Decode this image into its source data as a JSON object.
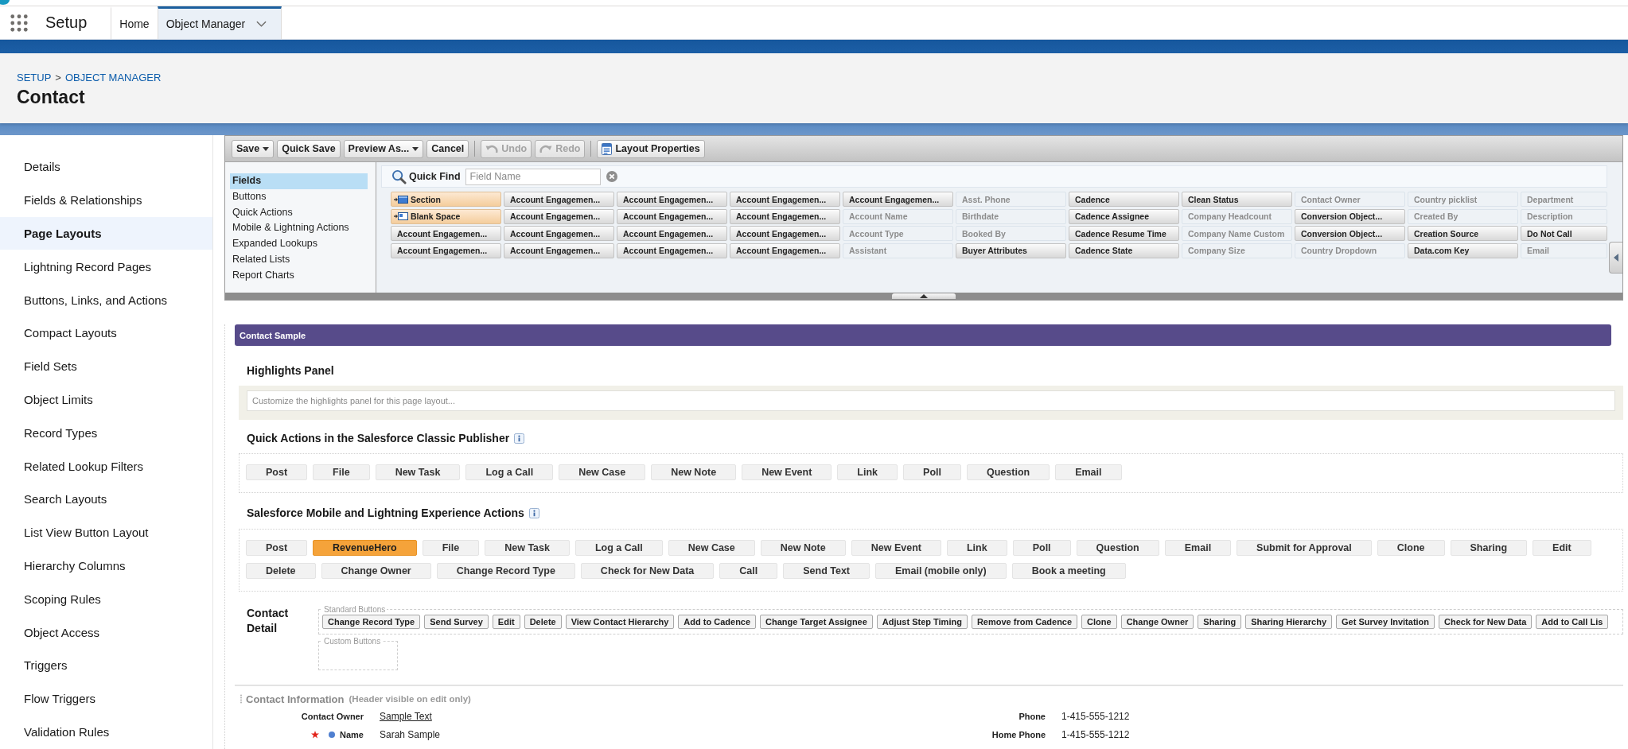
{
  "header": {
    "app_name": "Setup",
    "tabs": [
      {
        "label": "Home",
        "selected": false,
        "menu": false
      },
      {
        "label": "Object Manager",
        "selected": true,
        "menu": true
      }
    ]
  },
  "page_header": {
    "breadcrumb": [
      "SETUP",
      "OBJECT MANAGER"
    ],
    "separator": ">",
    "title": "Contact"
  },
  "sidebar": {
    "items": [
      {
        "label": "Details",
        "selected": false
      },
      {
        "label": "Fields & Relationships",
        "selected": false
      },
      {
        "label": "Page Layouts",
        "selected": true
      },
      {
        "label": "Lightning Record Pages",
        "selected": false
      },
      {
        "label": "Buttons, Links, and Actions",
        "selected": false
      },
      {
        "label": "Compact Layouts",
        "selected": false
      },
      {
        "label": "Field Sets",
        "selected": false
      },
      {
        "label": "Object Limits",
        "selected": false
      },
      {
        "label": "Record Types",
        "selected": false
      },
      {
        "label": "Related Lookup Filters",
        "selected": false
      },
      {
        "label": "Search Layouts",
        "selected": false
      },
      {
        "label": "List View Button Layout",
        "selected": false
      },
      {
        "label": "Hierarchy Columns",
        "selected": false
      },
      {
        "label": "Scoping Rules",
        "selected": false
      },
      {
        "label": "Object Access",
        "selected": false
      },
      {
        "label": "Triggers",
        "selected": false
      },
      {
        "label": "Flow Triggers",
        "selected": false
      },
      {
        "label": "Validation Rules",
        "selected": false
      }
    ]
  },
  "palette": {
    "toolbar": [
      {
        "label": "Save",
        "kind": "dropdown",
        "disabled": false
      },
      {
        "label": "Quick Save",
        "kind": "plain",
        "disabled": false
      },
      {
        "label": "Preview As...",
        "kind": "dropdown",
        "disabled": false
      },
      {
        "label": "Cancel",
        "kind": "plain",
        "disabled": false
      },
      {
        "label": "Undo",
        "kind": "undo",
        "disabled": true
      },
      {
        "label": "Redo",
        "kind": "redo",
        "disabled": true
      },
      {
        "label": "Layout Properties",
        "kind": "properties",
        "disabled": false
      }
    ],
    "categories": [
      {
        "label": "Fields",
        "selected": true
      },
      {
        "label": "Buttons",
        "selected": false
      },
      {
        "label": "Quick Actions",
        "selected": false
      },
      {
        "label": "Mobile & Lightning Actions",
        "selected": false
      },
      {
        "label": "Expanded Lookups",
        "selected": false
      },
      {
        "label": "Related Lists",
        "selected": false
      },
      {
        "label": "Report Charts",
        "selected": false
      }
    ],
    "quick_find": {
      "label": "Quick Find",
      "placeholder": "Field Name"
    },
    "items": [
      {
        "label": "Section",
        "kind": "section",
        "used": false
      },
      {
        "label": "Account Engagemen...",
        "kind": "field",
        "used": false
      },
      {
        "label": "Account Engagemen...",
        "kind": "field",
        "used": false
      },
      {
        "label": "Account Engagemen...",
        "kind": "field",
        "used": false
      },
      {
        "label": "Account Engagemen...",
        "kind": "field",
        "used": false
      },
      {
        "label": "Asst. Phone",
        "kind": "field",
        "used": true
      },
      {
        "label": "Cadence",
        "kind": "field",
        "used": false
      },
      {
        "label": "Clean Status",
        "kind": "field",
        "used": false
      },
      {
        "label": "Contact Owner",
        "kind": "field",
        "used": true
      },
      {
        "label": "Country picklist",
        "kind": "field",
        "used": true
      },
      {
        "label": "Department",
        "kind": "field",
        "used": true
      },
      {
        "label": "Blank Space",
        "kind": "blank",
        "used": false
      },
      {
        "label": "Account Engagemen...",
        "kind": "field",
        "used": false
      },
      {
        "label": "Account Engagemen...",
        "kind": "field",
        "used": false
      },
      {
        "label": "Account Engagemen...",
        "kind": "field",
        "used": false
      },
      {
        "label": "Account Name",
        "kind": "field",
        "used": true
      },
      {
        "label": "Birthdate",
        "kind": "field",
        "used": true
      },
      {
        "label": "Cadence Assignee",
        "kind": "field",
        "used": false
      },
      {
        "label": "Company Headcount",
        "kind": "field",
        "used": true
      },
      {
        "label": "Conversion Object...",
        "kind": "field",
        "used": false
      },
      {
        "label": "Created By",
        "kind": "field",
        "used": true
      },
      {
        "label": "Description",
        "kind": "field",
        "used": true
      },
      {
        "label": "Account Engagemen...",
        "kind": "field",
        "used": false
      },
      {
        "label": "Account Engagemen...",
        "kind": "field",
        "used": false
      },
      {
        "label": "Account Engagemen...",
        "kind": "field",
        "used": false
      },
      {
        "label": "Account Engagemen...",
        "kind": "field",
        "used": false
      },
      {
        "label": "Account Type",
        "kind": "field",
        "used": true
      },
      {
        "label": "Booked By",
        "kind": "field",
        "used": true
      },
      {
        "label": "Cadence Resume Time",
        "kind": "field",
        "used": false
      },
      {
        "label": "Company Name Custom",
        "kind": "field",
        "used": true
      },
      {
        "label": "Conversion Object...",
        "kind": "field",
        "used": false
      },
      {
        "label": "Creation Source",
        "kind": "field",
        "used": false
      },
      {
        "label": "Do Not Call",
        "kind": "field",
        "used": false
      },
      {
        "label": "Account Engagemen...",
        "kind": "field",
        "used": false
      },
      {
        "label": "Account Engagemen...",
        "kind": "field",
        "used": false
      },
      {
        "label": "Account Engagemen...",
        "kind": "field",
        "used": false
      },
      {
        "label": "Account Engagemen...",
        "kind": "field",
        "used": false
      },
      {
        "label": "Assistant",
        "kind": "field",
        "used": true
      },
      {
        "label": "Buyer Attributes",
        "kind": "field",
        "used": false
      },
      {
        "label": "Cadence State",
        "kind": "field",
        "used": false
      },
      {
        "label": "Company Size",
        "kind": "field",
        "used": true
      },
      {
        "label": "Country Dropdown",
        "kind": "field",
        "used": true
      },
      {
        "label": "Data.com Key",
        "kind": "field",
        "used": false
      },
      {
        "label": "Email",
        "kind": "field",
        "used": true
      }
    ]
  },
  "layout": {
    "title": "Contact Sample",
    "highlights_panel": {
      "heading": "Highlights Panel",
      "hint": "Customize the highlights panel for this page layout..."
    },
    "classic_actions": {
      "heading": "Quick Actions in the Salesforce Classic Publisher",
      "buttons": [
        {
          "label": "Post",
          "highlighted": false
        },
        {
          "label": "File",
          "highlighted": false
        },
        {
          "label": "New Task",
          "highlighted": false
        },
        {
          "label": "Log a Call",
          "highlighted": false
        },
        {
          "label": "New Case",
          "highlighted": false
        },
        {
          "label": "New Note",
          "highlighted": false
        },
        {
          "label": "New Event",
          "highlighted": false
        },
        {
          "label": "Link",
          "highlighted": false
        },
        {
          "label": "Poll",
          "highlighted": false
        },
        {
          "label": "Question",
          "highlighted": false
        },
        {
          "label": "Email",
          "highlighted": false
        }
      ]
    },
    "mobile_actions": {
      "heading": "Salesforce Mobile and Lightning Experience Actions",
      "buttons": [
        {
          "label": "Post",
          "highlighted": false
        },
        {
          "label": "RevenueHero",
          "highlighted": true
        },
        {
          "label": "File",
          "highlighted": false
        },
        {
          "label": "New Task",
          "highlighted": false
        },
        {
          "label": "Log a Call",
          "highlighted": false
        },
        {
          "label": "New Case",
          "highlighted": false
        },
        {
          "label": "New Note",
          "highlighted": false
        },
        {
          "label": "New Event",
          "highlighted": false
        },
        {
          "label": "Link",
          "highlighted": false
        },
        {
          "label": "Poll",
          "highlighted": false
        },
        {
          "label": "Question",
          "highlighted": false
        },
        {
          "label": "Email",
          "highlighted": false
        },
        {
          "label": "Submit for Approval",
          "highlighted": false
        },
        {
          "label": "Clone",
          "highlighted": false
        },
        {
          "label": "Sharing",
          "highlighted": false
        },
        {
          "label": "Edit",
          "highlighted": false
        },
        {
          "label": "Delete",
          "highlighted": false
        },
        {
          "label": "Change Owner",
          "highlighted": false
        },
        {
          "label": "Change Record Type",
          "highlighted": false
        },
        {
          "label": "Check for New Data",
          "highlighted": false
        },
        {
          "label": "Call",
          "highlighted": false
        },
        {
          "label": "Send Text",
          "highlighted": false
        },
        {
          "label": "Email (mobile only)",
          "highlighted": false
        },
        {
          "label": "Book a meeting",
          "highlighted": false
        }
      ]
    },
    "detail": {
      "label": "Contact Detail",
      "standard_buttons": {
        "legend": "Standard Buttons",
        "buttons": [
          "Change Record Type",
          "Send Survey",
          "Edit",
          "Delete",
          "View Contact Hierarchy",
          "Add to Cadence",
          "Change Target Assignee",
          "Adjust Step Timing",
          "Remove from Cadence",
          "Clone",
          "Change Owner",
          "Sharing",
          "Sharing Hierarchy",
          "Get Survey Invitation",
          "Check for New Data",
          "Add to Call Lis"
        ]
      },
      "custom_buttons": {
        "legend": "Custom Buttons"
      }
    },
    "section": {
      "title": "Contact Information",
      "note": "(Header visible on edit only)",
      "fields": [
        {
          "label": "Contact Owner",
          "value": "Sample Text",
          "always_on_layout": false,
          "required": false,
          "link": true
        },
        {
          "label": "Phone",
          "value": "1-415-555-1212",
          "always_on_layout": false,
          "required": false,
          "link": false
        },
        {
          "label": "Name",
          "value": "Sarah Sample",
          "always_on_layout": true,
          "required": true,
          "link": false
        },
        {
          "label": "Home Phone",
          "value": "1-415-555-1212",
          "always_on_layout": false,
          "required": false,
          "link": false
        }
      ]
    }
  }
}
